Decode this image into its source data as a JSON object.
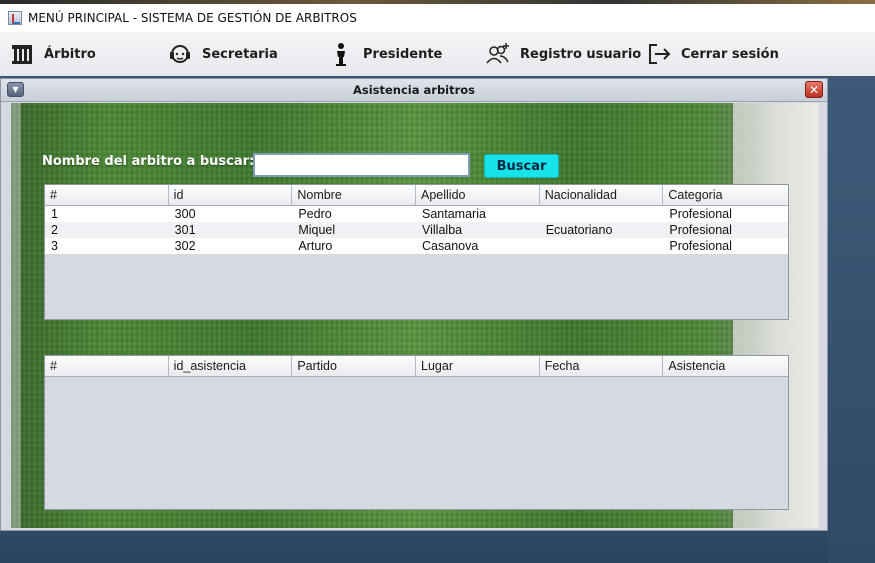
{
  "window": {
    "title": "MENÚ PRINCIPAL - SISTEMA DE GESTIÓN DE ARBITROS"
  },
  "menu": {
    "items": [
      {
        "label": "Árbitro",
        "icon": "referee-icon"
      },
      {
        "label": "Secretaria",
        "icon": "headset-icon"
      },
      {
        "label": "Presidente",
        "icon": "person-podium-icon"
      },
      {
        "label": "Registro usuario",
        "icon": "add-users-icon"
      },
      {
        "label": "Cerrar sesión",
        "icon": "logout-icon"
      }
    ]
  },
  "dialog": {
    "title": "Asistencia arbitros",
    "search": {
      "label": "Nombre del arbitro a buscar:",
      "value": "",
      "button_label": "Buscar",
      "button_color": "#17e4ea"
    }
  },
  "referees_table": {
    "columns": [
      "#",
      "id",
      "Nombre",
      "Apellido",
      "Nacionalidad",
      "Categoria"
    ],
    "rows": [
      [
        "1",
        "300",
        "Pedro",
        "Santamaria",
        "",
        "Profesional"
      ],
      [
        "2",
        "301",
        "Miquel",
        "Villalba",
        "Ecuatoriano",
        "Profesional"
      ],
      [
        "3",
        "302",
        "Arturo",
        "Casanova",
        "",
        "Profesional"
      ]
    ]
  },
  "attendance_table": {
    "columns": [
      "#",
      "id_asistencia",
      "Partido",
      "Lugar",
      "Fecha",
      "Asistencia"
    ],
    "rows": []
  }
}
